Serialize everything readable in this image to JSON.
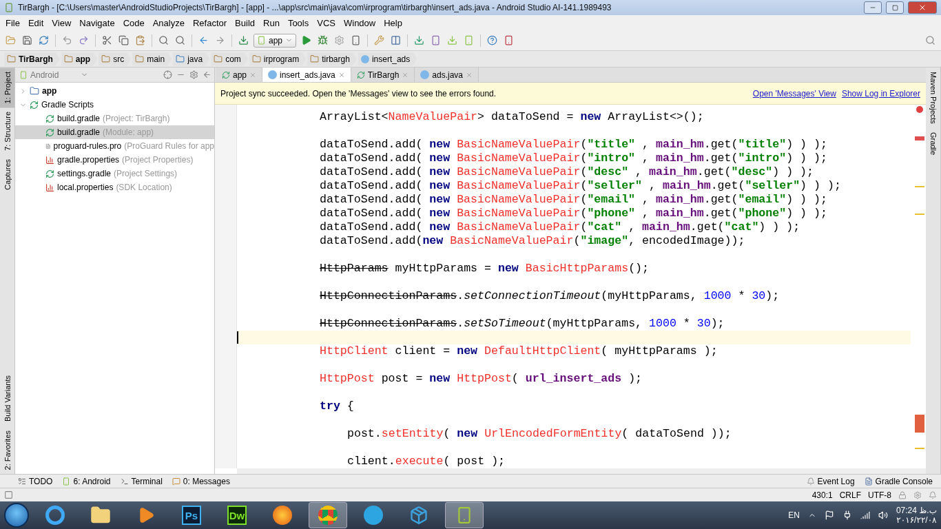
{
  "window": {
    "title": "TirBargh - [C:\\Users\\master\\AndroidStudioProjects\\TirBargh] - [app] - ...\\app\\src\\main\\java\\com\\irprogram\\tirbargh\\insert_ads.java - Android Studio AI-141.1989493"
  },
  "menu": [
    "File",
    "Edit",
    "View",
    "Navigate",
    "Code",
    "Analyze",
    "Refactor",
    "Build",
    "Run",
    "Tools",
    "VCS",
    "Window",
    "Help"
  ],
  "run_config": {
    "value": "app"
  },
  "breadcrumbs": [
    {
      "label": "TirBargh",
      "kind": "folder",
      "bold": true
    },
    {
      "label": "app",
      "kind": "folder",
      "bold": true
    },
    {
      "label": "src",
      "kind": "folder",
      "bold": false
    },
    {
      "label": "main",
      "kind": "folder",
      "bold": false
    },
    {
      "label": "java",
      "kind": "source",
      "bold": false
    },
    {
      "label": "com",
      "kind": "folder",
      "bold": false
    },
    {
      "label": "irprogram",
      "kind": "folder",
      "bold": false
    },
    {
      "label": "tirbargh",
      "kind": "folder",
      "bold": false
    },
    {
      "label": "insert_ads",
      "kind": "class",
      "bold": false
    }
  ],
  "left_tool_tabs": [
    {
      "label": "1: Project",
      "selected": true
    },
    {
      "label": "7: Structure",
      "selected": false
    },
    {
      "label": "Captures",
      "selected": false
    },
    {
      "label": "Build Variants",
      "selected": false
    },
    {
      "label": "2: Favorites",
      "selected": false
    }
  ],
  "right_tool_tabs": [
    {
      "label": "Maven Projects"
    },
    {
      "label": "Gradle"
    }
  ],
  "project_panel": {
    "view": "Android",
    "tree": [
      {
        "name": "app",
        "kind": "module",
        "expanded": false,
        "selected": false
      },
      {
        "name": "Gradle Scripts",
        "kind": "gradle",
        "expanded": true,
        "selected": false,
        "children": [
          {
            "name": "build.gradle",
            "detail": "(Project: TirBargh)",
            "kind": "gradle",
            "selected": false
          },
          {
            "name": "build.gradle",
            "detail": "(Module: app)",
            "kind": "gradle",
            "selected": true
          },
          {
            "name": "proguard-rules.pro",
            "detail": "(ProGuard Rules for app",
            "kind": "text",
            "selected": false
          },
          {
            "name": "gradle.properties",
            "detail": "(Project Properties)",
            "kind": "properties",
            "selected": false
          },
          {
            "name": "settings.gradle",
            "detail": "(Project Settings)",
            "kind": "gradle",
            "selected": false
          },
          {
            "name": "local.properties",
            "detail": "(SDK Location)",
            "kind": "properties",
            "selected": false
          }
        ]
      }
    ]
  },
  "editor_tabs": [
    {
      "label": "app",
      "kind": "gradle",
      "selected": false
    },
    {
      "label": "insert_ads.java",
      "kind": "class",
      "selected": true
    },
    {
      "label": "TirBargh",
      "kind": "gradle",
      "selected": false
    },
    {
      "label": "ads.java",
      "kind": "class",
      "selected": false
    }
  ],
  "notification": {
    "message": "Project sync succeeded. Open the 'Messages' view to see the errors found.",
    "links": [
      "Open 'Messages' View",
      "Show Log in Explorer"
    ]
  },
  "code_lines": [
    {
      "current": false,
      "tokens": [
        {
          "text": "ArrayList<",
          "kind": "plain"
        },
        {
          "text": "NameValuePair",
          "kind": "unresolved"
        },
        {
          "text": "> dataToSend = ",
          "kind": "plain"
        },
        {
          "text": "new",
          "kind": "keyword"
        },
        {
          "text": " ArrayList<>();",
          "kind": "plain"
        }
      ]
    },
    {
      "current": false
    },
    {
      "current": false,
      "tokens": [
        {
          "text": "dataToSend.add( ",
          "kind": "plain"
        },
        {
          "text": "new",
          "kind": "keyword"
        },
        {
          "text": " BasicNameValuePair",
          "kind": "unresolved"
        },
        {
          "text": "(",
          "kind": "plain"
        },
        {
          "text": "\"title\"",
          "kind": "string"
        },
        {
          "text": " , ",
          "kind": "plain"
        },
        {
          "text": "main_hm",
          "kind": "field"
        },
        {
          "text": ".get(",
          "kind": "plain"
        },
        {
          "text": "\"title\"",
          "kind": "string"
        },
        {
          "text": ") ) );",
          "kind": "plain"
        }
      ]
    },
    {
      "current": false,
      "tokens": [
        {
          "text": "dataToSend.add( ",
          "kind": "plain"
        },
        {
          "text": "new",
          "kind": "keyword"
        },
        {
          "text": " BasicNameValuePair",
          "kind": "unresolved"
        },
        {
          "text": "(",
          "kind": "plain"
        },
        {
          "text": "\"intro\"",
          "kind": "string"
        },
        {
          "text": " , ",
          "kind": "plain"
        },
        {
          "text": "main_hm",
          "kind": "field"
        },
        {
          "text": ".get(",
          "kind": "plain"
        },
        {
          "text": "\"intro\"",
          "kind": "string"
        },
        {
          "text": ") ) );",
          "kind": "plain"
        }
      ]
    },
    {
      "current": false,
      "tokens": [
        {
          "text": "dataToSend.add( ",
          "kind": "plain"
        },
        {
          "text": "new",
          "kind": "keyword"
        },
        {
          "text": " BasicNameValuePair",
          "kind": "unresolved"
        },
        {
          "text": "(",
          "kind": "plain"
        },
        {
          "text": "\"desc\"",
          "kind": "string"
        },
        {
          "text": " , ",
          "kind": "plain"
        },
        {
          "text": "main_hm",
          "kind": "field"
        },
        {
          "text": ".get(",
          "kind": "plain"
        },
        {
          "text": "\"desc\"",
          "kind": "string"
        },
        {
          "text": ") ) );",
          "kind": "plain"
        }
      ]
    },
    {
      "current": false,
      "tokens": [
        {
          "text": "dataToSend.add( ",
          "kind": "plain"
        },
        {
          "text": "new",
          "kind": "keyword"
        },
        {
          "text": " BasicNameValuePair",
          "kind": "unresolved"
        },
        {
          "text": "(",
          "kind": "plain"
        },
        {
          "text": "\"seller\"",
          "kind": "string"
        },
        {
          "text": " , ",
          "kind": "plain"
        },
        {
          "text": "main_hm",
          "kind": "field"
        },
        {
          "text": ".get(",
          "kind": "plain"
        },
        {
          "text": "\"seller\"",
          "kind": "string"
        },
        {
          "text": ") ) );",
          "kind": "plain"
        }
      ]
    },
    {
      "current": false,
      "tokens": [
        {
          "text": "dataToSend.add( ",
          "kind": "plain"
        },
        {
          "text": "new",
          "kind": "keyword"
        },
        {
          "text": " BasicNameValuePair",
          "kind": "unresolved"
        },
        {
          "text": "(",
          "kind": "plain"
        },
        {
          "text": "\"email\"",
          "kind": "string"
        },
        {
          "text": " , ",
          "kind": "plain"
        },
        {
          "text": "main_hm",
          "kind": "field"
        },
        {
          "text": ".get(",
          "kind": "plain"
        },
        {
          "text": "\"email\"",
          "kind": "string"
        },
        {
          "text": ") ) );",
          "kind": "plain"
        }
      ]
    },
    {
      "current": false,
      "tokens": [
        {
          "text": "dataToSend.add( ",
          "kind": "plain"
        },
        {
          "text": "new",
          "kind": "keyword"
        },
        {
          "text": " BasicNameValuePair",
          "kind": "unresolved"
        },
        {
          "text": "(",
          "kind": "plain"
        },
        {
          "text": "\"phone\"",
          "kind": "string"
        },
        {
          "text": " , ",
          "kind": "plain"
        },
        {
          "text": "main_hm",
          "kind": "field"
        },
        {
          "text": ".get(",
          "kind": "plain"
        },
        {
          "text": "\"phone\"",
          "kind": "string"
        },
        {
          "text": ") ) );",
          "kind": "plain"
        }
      ]
    },
    {
      "current": false,
      "tokens": [
        {
          "text": "dataToSend.add( ",
          "kind": "plain"
        },
        {
          "text": "new",
          "kind": "keyword"
        },
        {
          "text": " BasicNameValuePair",
          "kind": "unresolved"
        },
        {
          "text": "(",
          "kind": "plain"
        },
        {
          "text": "\"cat\"",
          "kind": "string"
        },
        {
          "text": " , ",
          "kind": "plain"
        },
        {
          "text": "main_hm",
          "kind": "field"
        },
        {
          "text": ".get(",
          "kind": "plain"
        },
        {
          "text": "\"cat\"",
          "kind": "string"
        },
        {
          "text": ") ) );",
          "kind": "plain"
        }
      ]
    },
    {
      "current": false,
      "tokens": [
        {
          "text": "dataToSend.add(",
          "kind": "plain"
        },
        {
          "text": "new",
          "kind": "keyword"
        },
        {
          "text": " BasicNameValuePair",
          "kind": "unresolved"
        },
        {
          "text": "(",
          "kind": "plain"
        },
        {
          "text": "\"image\"",
          "kind": "string"
        },
        {
          "text": ", encodedImage));",
          "kind": "plain"
        }
      ]
    },
    {
      "current": false
    },
    {
      "current": false,
      "tokens": [
        {
          "text": "HttpParams",
          "kind": "deprecated"
        },
        {
          "text": " myHttpParams = ",
          "kind": "plain"
        },
        {
          "text": "new",
          "kind": "keyword"
        },
        {
          "text": " BasicHttpParams",
          "kind": "unresolved"
        },
        {
          "text": "();",
          "kind": "plain"
        }
      ]
    },
    {
      "current": false
    },
    {
      "current": false,
      "tokens": [
        {
          "text": "HttpConnectionParams",
          "kind": "deprecated"
        },
        {
          "text": ".",
          "kind": "plain"
        },
        {
          "text": "setConnectionTimeout",
          "kind": "static"
        },
        {
          "text": "(myHttpParams, ",
          "kind": "plain"
        },
        {
          "text": "1000",
          "kind": "number"
        },
        {
          "text": " * ",
          "kind": "plain"
        },
        {
          "text": "30",
          "kind": "number"
        },
        {
          "text": ");",
          "kind": "plain"
        }
      ]
    },
    {
      "current": false
    },
    {
      "current": false,
      "tokens": [
        {
          "text": "HttpConnectionParams",
          "kind": "deprecated"
        },
        {
          "text": ".",
          "kind": "plain"
        },
        {
          "text": "setSoTimeout",
          "kind": "static"
        },
        {
          "text": "(myHttpParams, ",
          "kind": "plain"
        },
        {
          "text": "1000",
          "kind": "number"
        },
        {
          "text": " * ",
          "kind": "plain"
        },
        {
          "text": "30",
          "kind": "number"
        },
        {
          "text": ");",
          "kind": "plain"
        }
      ]
    },
    {
      "current": true
    },
    {
      "current": false,
      "tokens": [
        {
          "text": "HttpClient",
          "kind": "unresolved"
        },
        {
          "text": " client = ",
          "kind": "plain"
        },
        {
          "text": "new",
          "kind": "keyword"
        },
        {
          "text": " DefaultHttpClient",
          "kind": "unresolved"
        },
        {
          "text": "( myHttpParams );",
          "kind": "plain"
        }
      ]
    },
    {
      "current": false
    },
    {
      "current": false,
      "tokens": [
        {
          "text": "HttpPost",
          "kind": "unresolved"
        },
        {
          "text": " post = ",
          "kind": "plain"
        },
        {
          "text": "new",
          "kind": "keyword"
        },
        {
          "text": " HttpPost",
          "kind": "unresolved"
        },
        {
          "text": "( ",
          "kind": "plain"
        },
        {
          "text": "url_insert_ads",
          "kind": "field"
        },
        {
          "text": " );",
          "kind": "plain"
        }
      ]
    },
    {
      "current": false
    },
    {
      "current": false,
      "tokens": [
        {
          "text": "try",
          "kind": "keyword"
        },
        {
          "text": " {",
          "kind": "plain"
        }
      ],
      "children": [
        {
          "current": false
        },
        {
          "current": false,
          "tokens": [
            {
              "text": "post.",
              "kind": "plain"
            },
            {
              "text": "setEntity",
              "kind": "unresolved"
            },
            {
              "text": "( ",
              "kind": "plain"
            },
            {
              "text": "new",
              "kind": "keyword"
            },
            {
              "text": " UrlEncodedFormEntity",
              "kind": "unresolved"
            },
            {
              "text": "( dataToSend ));",
              "kind": "plain"
            }
          ]
        },
        {
          "current": false
        },
        {
          "current": false,
          "tokens": [
            {
              "text": "client.",
              "kind": "plain"
            },
            {
              "text": "execute",
              "kind": "unresolved"
            },
            {
              "text": "( post );",
              "kind": "plain"
            }
          ]
        }
      ]
    }
  ],
  "bottom_tool_tabs": [
    {
      "label": "TODO",
      "kind": "todo"
    },
    {
      "label": "6: Android",
      "kind": "android"
    },
    {
      "label": "Terminal",
      "kind": "terminal"
    },
    {
      "label": "0: Messages",
      "kind": "messages"
    }
  ],
  "bottom_right_tabs": [
    {
      "label": "Event Log",
      "kind": "log"
    },
    {
      "label": "Gradle Console",
      "kind": "console"
    }
  ],
  "status_bar": {
    "position": "430:1",
    "line_separator": "CRLF",
    "encoding": "UTF-8"
  },
  "taskbar": {
    "apps": [
      {
        "kind": "ie",
        "active": false
      },
      {
        "kind": "folder",
        "active": false
      },
      {
        "kind": "media",
        "active": false
      },
      {
        "kind": "ps",
        "label": "Ps",
        "active": false
      },
      {
        "kind": "dw",
        "label": "Dw",
        "active": false
      },
      {
        "kind": "firefox",
        "active": false
      },
      {
        "kind": "chrome",
        "active": true
      },
      {
        "kind": "telegram",
        "active": false
      },
      {
        "kind": "box",
        "active": false
      },
      {
        "kind": "android",
        "active": true
      }
    ],
    "language": "EN",
    "time": "07:24 ب.ظ",
    "date": "۲۰۱۶/۲۲/۰۸"
  }
}
